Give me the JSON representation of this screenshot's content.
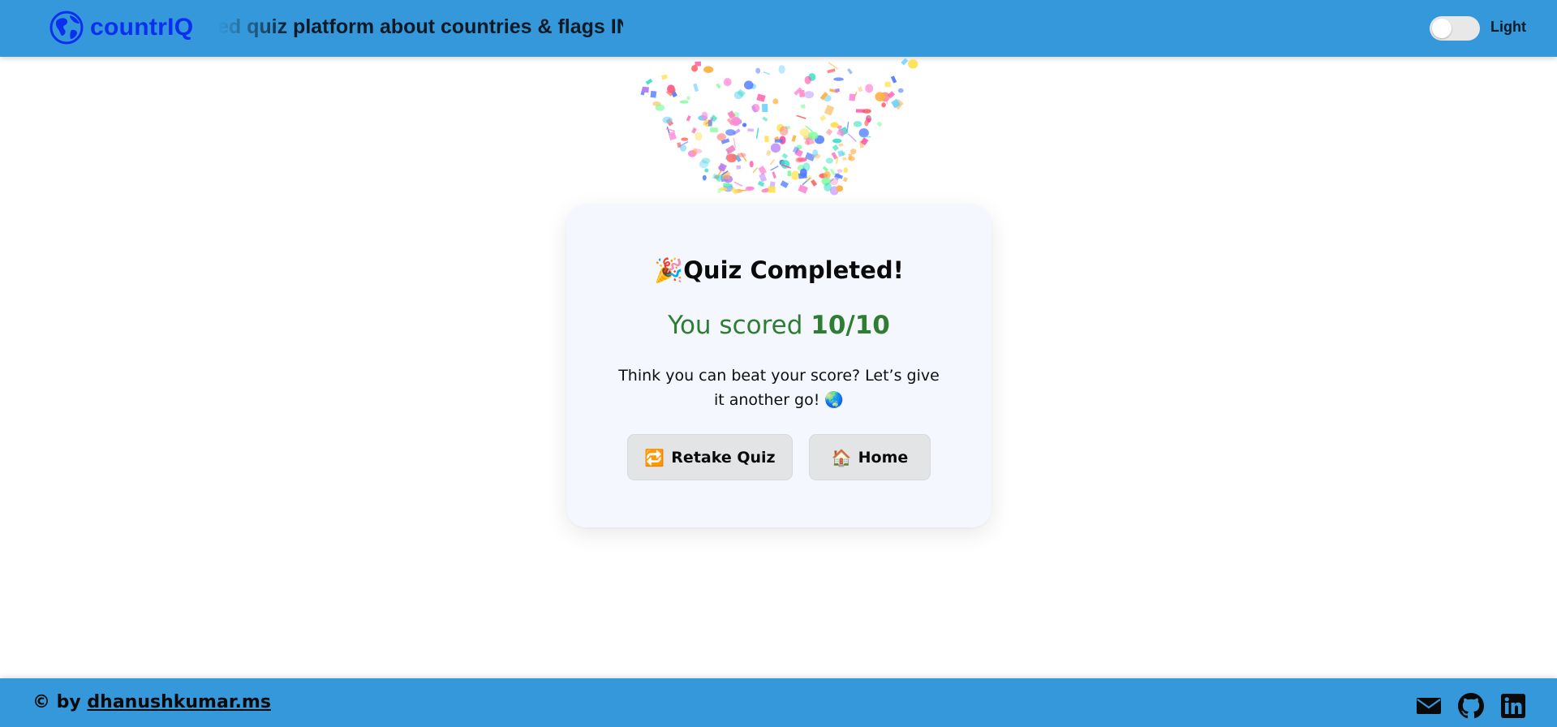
{
  "header": {
    "logo_text": "countrIQ",
    "tagline": "ed quiz platform about countries & flags IN!",
    "theme_label": "Light"
  },
  "result": {
    "title_emoji": "🎉",
    "title": "Quiz Completed!",
    "score_prefix": "You scored ",
    "score_value": "10/10",
    "message": "Think you can beat your score? Let’s give it another go! 🌏"
  },
  "actions": {
    "retake_icon": "🔁",
    "retake_label": "Retake Quiz",
    "home_icon": "🏠",
    "home_label": "Home"
  },
  "footer": {
    "credit_prefix": "© by ",
    "credit_link": "dhanushkumar.ms",
    "social": [
      "envelope-icon",
      "github-icon",
      "linkedin-icon"
    ]
  },
  "colors": {
    "header_bg": "#3498db",
    "logo": "#0b2ff0",
    "score_green": "#2e7d32",
    "card_bg": "#f4f8fe"
  }
}
